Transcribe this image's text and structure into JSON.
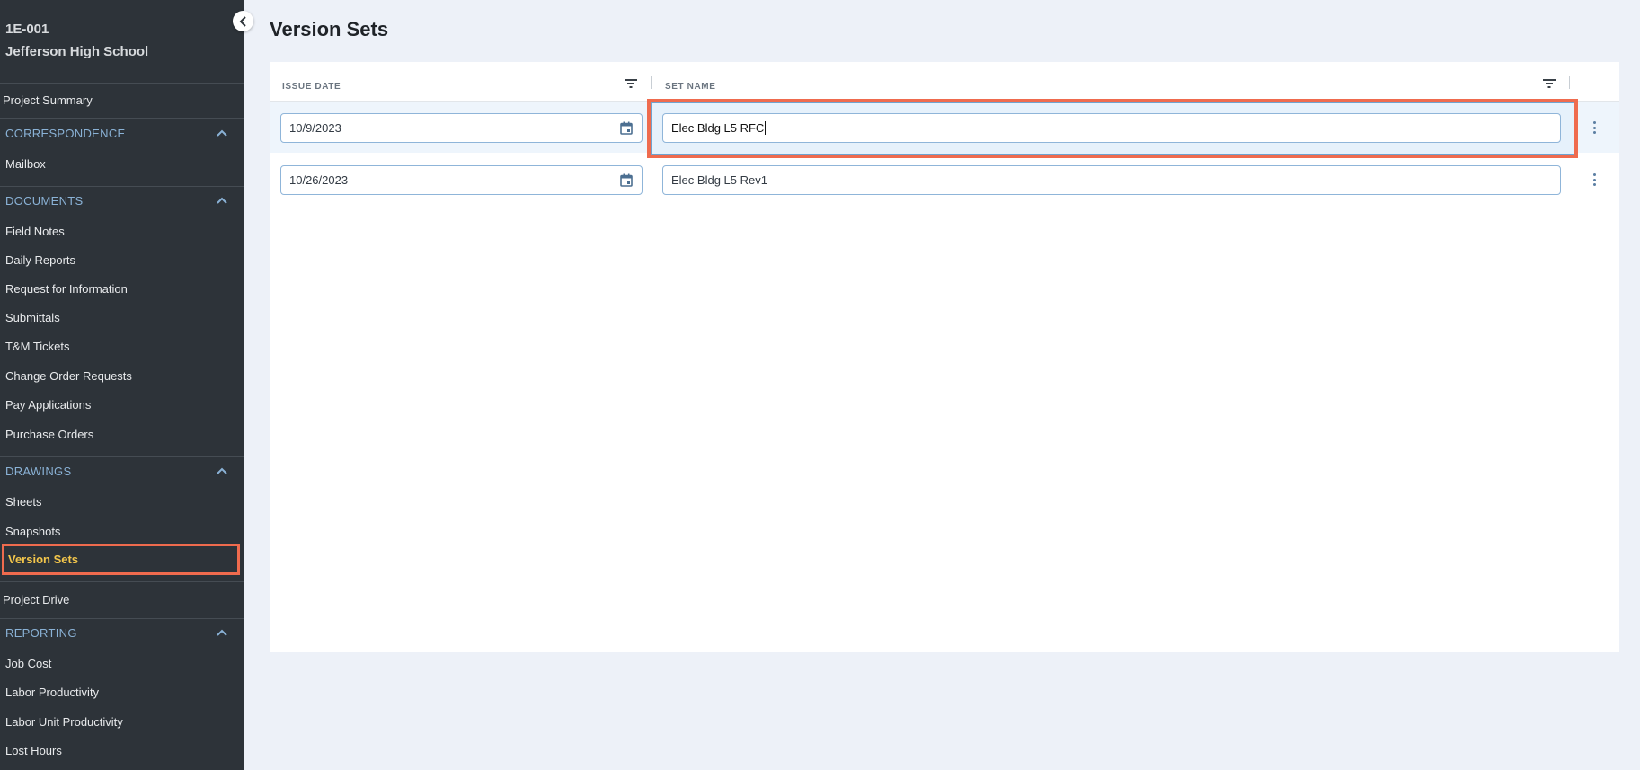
{
  "project": {
    "code": "1E-001",
    "name": "Jefferson High School"
  },
  "sidebar": {
    "project_summary": "Project Summary",
    "correspondence": {
      "label": "CORRESPONDENCE",
      "items": [
        "Mailbox"
      ]
    },
    "documents": {
      "label": "DOCUMENTS",
      "items": [
        "Field Notes",
        "Daily Reports",
        "Request for Information",
        "Submittals",
        "T&M Tickets",
        "Change Order Requests",
        "Pay Applications",
        "Purchase Orders"
      ]
    },
    "drawings": {
      "label": "DRAWINGS",
      "items": [
        "Sheets",
        "Snapshots"
      ],
      "active": "Version Sets"
    },
    "project_drive": "Project Drive",
    "reporting": {
      "label": "REPORTING",
      "items": [
        "Job Cost",
        "Labor Productivity",
        "Labor Unit Productivity",
        "Lost Hours"
      ]
    }
  },
  "main": {
    "title": "Version Sets",
    "columns": {
      "issue_date": "ISSUE DATE",
      "set_name": "SET NAME"
    },
    "rows": [
      {
        "issue_date": "10/9/2023",
        "set_name": "Elec Bldg L5 RFC",
        "editing": true
      },
      {
        "issue_date": "10/26/2023",
        "set_name": "Elec Bldg L5 Rev1",
        "editing": false
      }
    ]
  },
  "colors": {
    "sidebar_bg": "#2d3339",
    "accent_link": "#8ab2d6",
    "active_text": "#f3c64b",
    "highlight": "#ef6b4e",
    "page_bg": "#edf1f8"
  }
}
